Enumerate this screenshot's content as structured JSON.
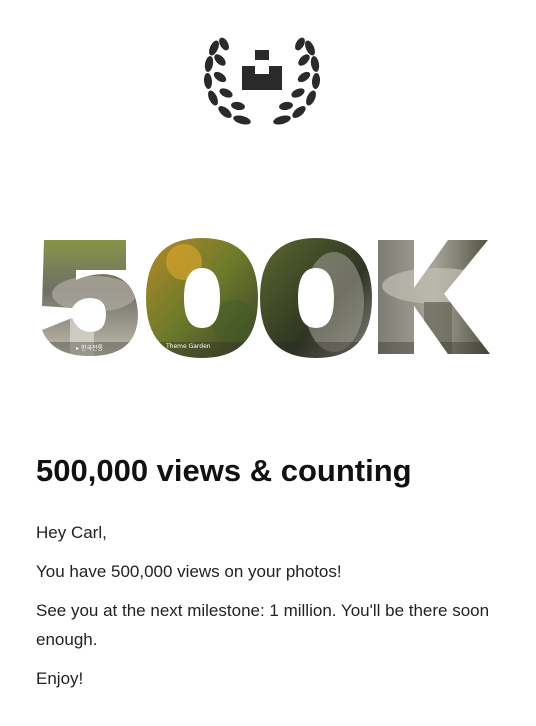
{
  "brand": {
    "logo_icon": "unsplash-laurel-award-icon",
    "logo_color": "#222222"
  },
  "hero": {
    "text": "500K",
    "fill": "photo-texture-garden",
    "photo_captions": [
      "▸ 한국전통",
      "Theme Garden"
    ]
  },
  "email": {
    "headline": "500,000 views & counting",
    "greeting": "Hey Carl,",
    "line1": "You have 500,000 views on your photos!",
    "line2": "See you at the next milestone: 1 million. You'll be there soon enough.",
    "signoff": "Enjoy!"
  }
}
